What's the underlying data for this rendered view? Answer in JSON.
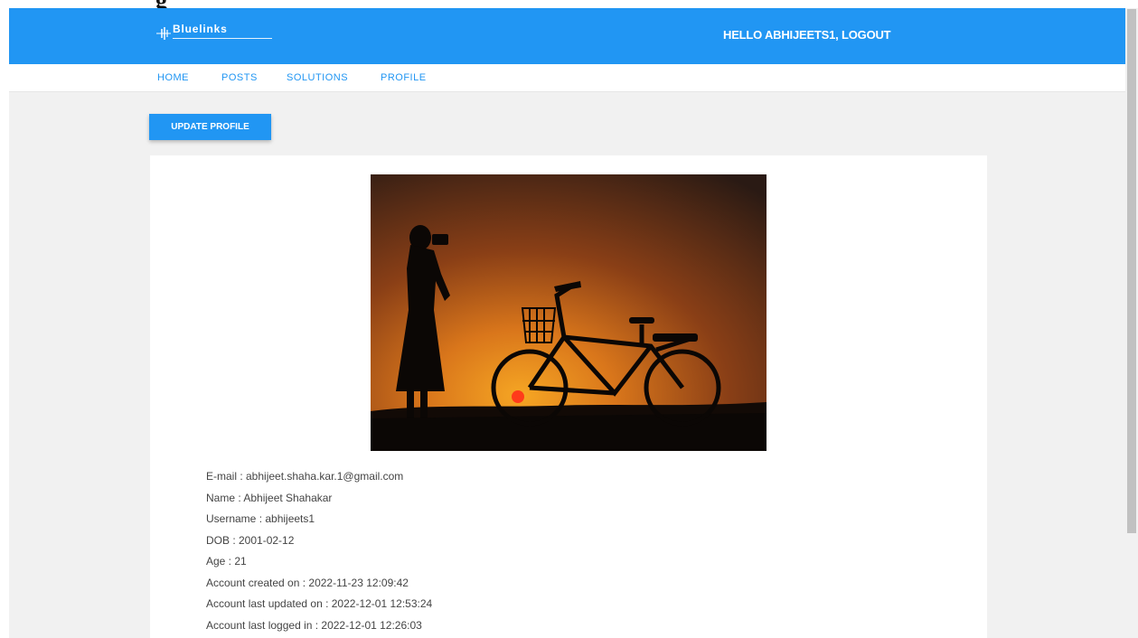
{
  "header": {
    "brand": "Bluelinks",
    "greeting": "HELLO ABHIJEETS1, ",
    "logout_label": "LOGOUT"
  },
  "nav": {
    "items": [
      "HOME",
      "POSTS",
      "SOLUTIONS",
      "PROFILE"
    ]
  },
  "toolbar": {
    "update_profile_label": "UPDATE PROFILE"
  },
  "profile": {
    "details": [
      "E-mail : abhijeet.shaha.kar.1@gmail.com",
      "Name : Abhijeet Shahakar",
      "Username : abhijeets1",
      "DOB : 2001-02-12",
      "Age : 21",
      "Account created on : 2022-11-23 12:09:42",
      "Account last updated on : 2022-12-01 12:53:24",
      "Account last logged in : 2022-12-01 12:26:03"
    ]
  },
  "colors": {
    "primary": "#2196f3",
    "background": "#f1f1f1",
    "card": "#ffffff"
  }
}
